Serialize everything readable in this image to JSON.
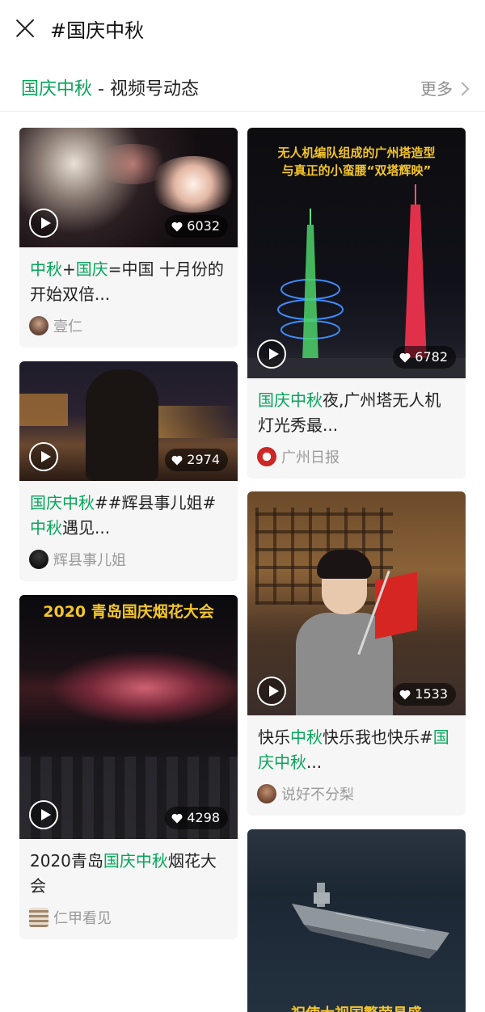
{
  "topbar": {
    "title": "#国庆中秋"
  },
  "section": {
    "title_keyword": "国庆中秋",
    "title_rest": " - 视频号动态",
    "more_label": "更多"
  },
  "colors": {
    "keyword": "#07a55a",
    "muted": "#9a9a9a"
  },
  "cards": [
    {
      "likes": "6032",
      "title_parts": [
        "中秋",
        "+",
        "国庆",
        "=中国 十月份的开始双倍..."
      ],
      "author": "壹仁"
    },
    {
      "likes": "2974",
      "title_parts": [
        "国庆中秋",
        "##辉县事儿姐#",
        "中秋",
        "遇见..."
      ],
      "author": "辉县事儿姐"
    },
    {
      "thumb_caption": "2020 青岛国庆烟花大会",
      "likes": "4298",
      "title_parts": [
        "2020青岛",
        "国庆中秋",
        "烟花大会"
      ],
      "author": "仁甲看见"
    },
    {
      "thumb_caption_line1": "无人机编队组成的广州塔造型",
      "thumb_caption_line2": "与真正的小蛮腰“双塔辉映”",
      "likes": "6782",
      "title_parts": [
        "国庆中秋",
        "夜,广州塔无人机灯光秀最..."
      ],
      "author": "广州日报"
    },
    {
      "likes": "1533",
      "title_parts": [
        "快乐",
        "中秋",
        "快乐我也快乐#",
        "国庆中秋",
        "..."
      ],
      "author": "说好不分梨"
    },
    {
      "thumb_caption": "祝使大视国繁荣昌盛"
    }
  ]
}
